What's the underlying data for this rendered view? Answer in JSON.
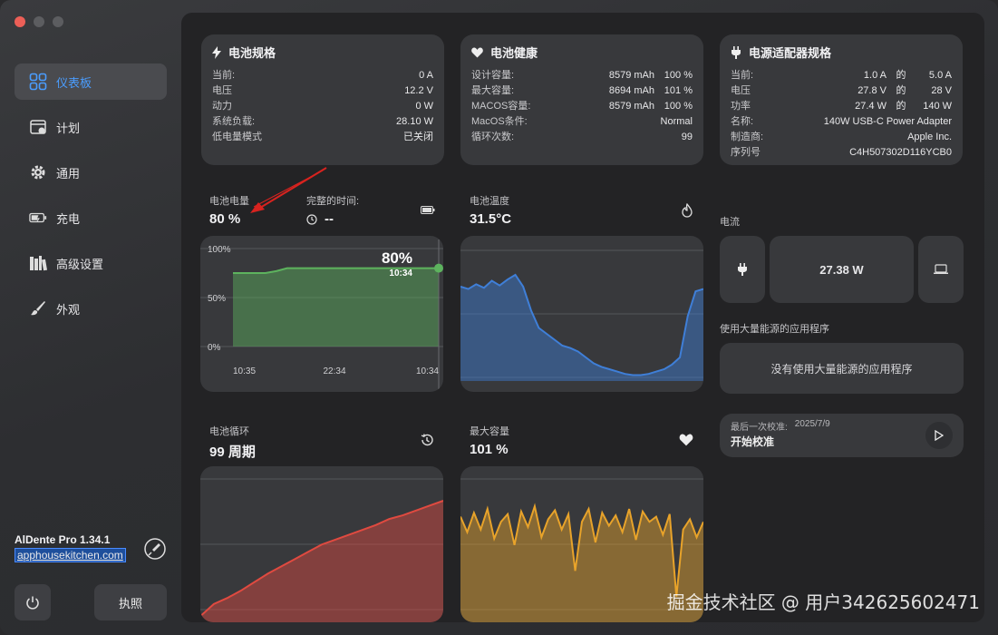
{
  "sidebar": {
    "items": [
      {
        "label": "仪表板",
        "icon": "dashboard-icon",
        "active": true
      },
      {
        "label": "计划",
        "icon": "calendar-icon",
        "active": false
      },
      {
        "label": "通用",
        "icon": "gear-icon",
        "active": false
      },
      {
        "label": "充电",
        "icon": "battery-charging-icon",
        "active": false
      },
      {
        "label": "高级设置",
        "icon": "books-icon",
        "active": false
      },
      {
        "label": "外观",
        "icon": "brush-icon",
        "active": false
      }
    ],
    "app_name": "AlDente Pro 1.34.1",
    "app_link": "apphousekitchen.com",
    "apply_label": "执照"
  },
  "battery_spec": {
    "title": "电池规格",
    "rows": [
      {
        "label": "当前:",
        "value": "0 A"
      },
      {
        "label": "电压",
        "value": "12.2 V"
      },
      {
        "label": "动力",
        "value": "0 W"
      },
      {
        "label": "系统负载:",
        "value": "28.10 W"
      },
      {
        "label": "低电量模式",
        "value": "已关闭"
      }
    ]
  },
  "battery_health": {
    "title": "电池健康",
    "rows": [
      {
        "label": "设计容量:",
        "value": "8579 mAh",
        "pct": "100 %"
      },
      {
        "label": "最大容量:",
        "value": "8694 mAh",
        "pct": "101 %"
      },
      {
        "label": "MACOS容量:",
        "value": "8579 mAh",
        "pct": "100 %"
      },
      {
        "label": "MacOS条件:",
        "value": "Normal",
        "pct": ""
      },
      {
        "label": "循环次数:",
        "value": "99",
        "pct": ""
      }
    ]
  },
  "adapter_spec": {
    "title": "电源适配器规格",
    "rows": [
      {
        "label": "当前:",
        "a": "1.0 A",
        "mid": "的",
        "b": "5.0 A"
      },
      {
        "label": "电压",
        "a": "27.8 V",
        "mid": "的",
        "b": "28 V"
      },
      {
        "label": "功率",
        "a": "27.4 W",
        "mid": "的",
        "b": "140 W"
      },
      {
        "label": "名称:",
        "a": "",
        "mid": "",
        "b": "140W USB-C Power Adapter"
      },
      {
        "label": "制造商:",
        "a": "",
        "mid": "",
        "b": "Apple Inc."
      },
      {
        "label": "序列号",
        "a": "",
        "mid": "",
        "b": "C4H507302D116YCB0"
      }
    ]
  },
  "charge": {
    "label": "电池电量",
    "value": "80 %",
    "full_time_label": "完整的时间:",
    "full_time_value": "--",
    "chart_overlay_value": "80%",
    "chart_overlay_time": "10:34"
  },
  "temperature": {
    "label": "电池温度",
    "value": "31.5°C"
  },
  "cycles": {
    "label": "电池循环",
    "value": "99 周期"
  },
  "max_capacity": {
    "label": "最大容量",
    "value": "101 %"
  },
  "current": {
    "label": "电流",
    "power_value": "27.38 W"
  },
  "energy_apps": {
    "label": "使用大量能源的应用程序",
    "empty_text": "没有使用大量能源的应用程序"
  },
  "calibration": {
    "last_label": "最后一次校准:",
    "last_date": "2025/7/9",
    "start_label": "开始校准"
  },
  "watermark": "掘金技术社区 @ 用户342625602471",
  "chart_data": [
    {
      "type": "area",
      "title": "电池电量",
      "y_tick_labels": [
        "100%",
        "50%",
        "0%"
      ],
      "x_tick_labels": [
        "10:35",
        "22:34",
        "10:34"
      ],
      "ylim": [
        0,
        100
      ],
      "color": "#5db35e",
      "series": [
        {
          "values": [
            75,
            75,
            75,
            75,
            77,
            80,
            80,
            80,
            80,
            80,
            80,
            80,
            80,
            80,
            80,
            80,
            80,
            80,
            80,
            80
          ]
        }
      ]
    },
    {
      "type": "area",
      "title": "电池温度",
      "color": "#3f7fd8",
      "series": [
        {
          "values": [
            80,
            78,
            82,
            79,
            85,
            81,
            86,
            90,
            80,
            60,
            45,
            40,
            35,
            30,
            28,
            25,
            20,
            15,
            12,
            10,
            8,
            6,
            5,
            5,
            6,
            8,
            10,
            14,
            20,
            55,
            76,
            78
          ]
        }
      ]
    },
    {
      "type": "area",
      "title": "电池循环",
      "color": "#e04a40",
      "series": [
        {
          "values": [
            5,
            15,
            20,
            26,
            33,
            40,
            46,
            52,
            58,
            64,
            68,
            72,
            76,
            80,
            85,
            88,
            92,
            96,
            100
          ]
        }
      ]
    },
    {
      "type": "area",
      "title": "最大容量",
      "color": "#e8a32a",
      "series": [
        {
          "values": [
            82,
            70,
            85,
            72,
            88,
            65,
            78,
            84,
            60,
            86,
            74,
            90,
            66,
            80,
            87,
            72,
            84,
            40,
            78,
            88,
            62,
            85,
            75,
            83,
            70,
            88,
            64,
            86,
            78,
            82,
            68,
            84,
            20,
            72,
            80,
            66,
            78
          ]
        }
      ]
    }
  ]
}
